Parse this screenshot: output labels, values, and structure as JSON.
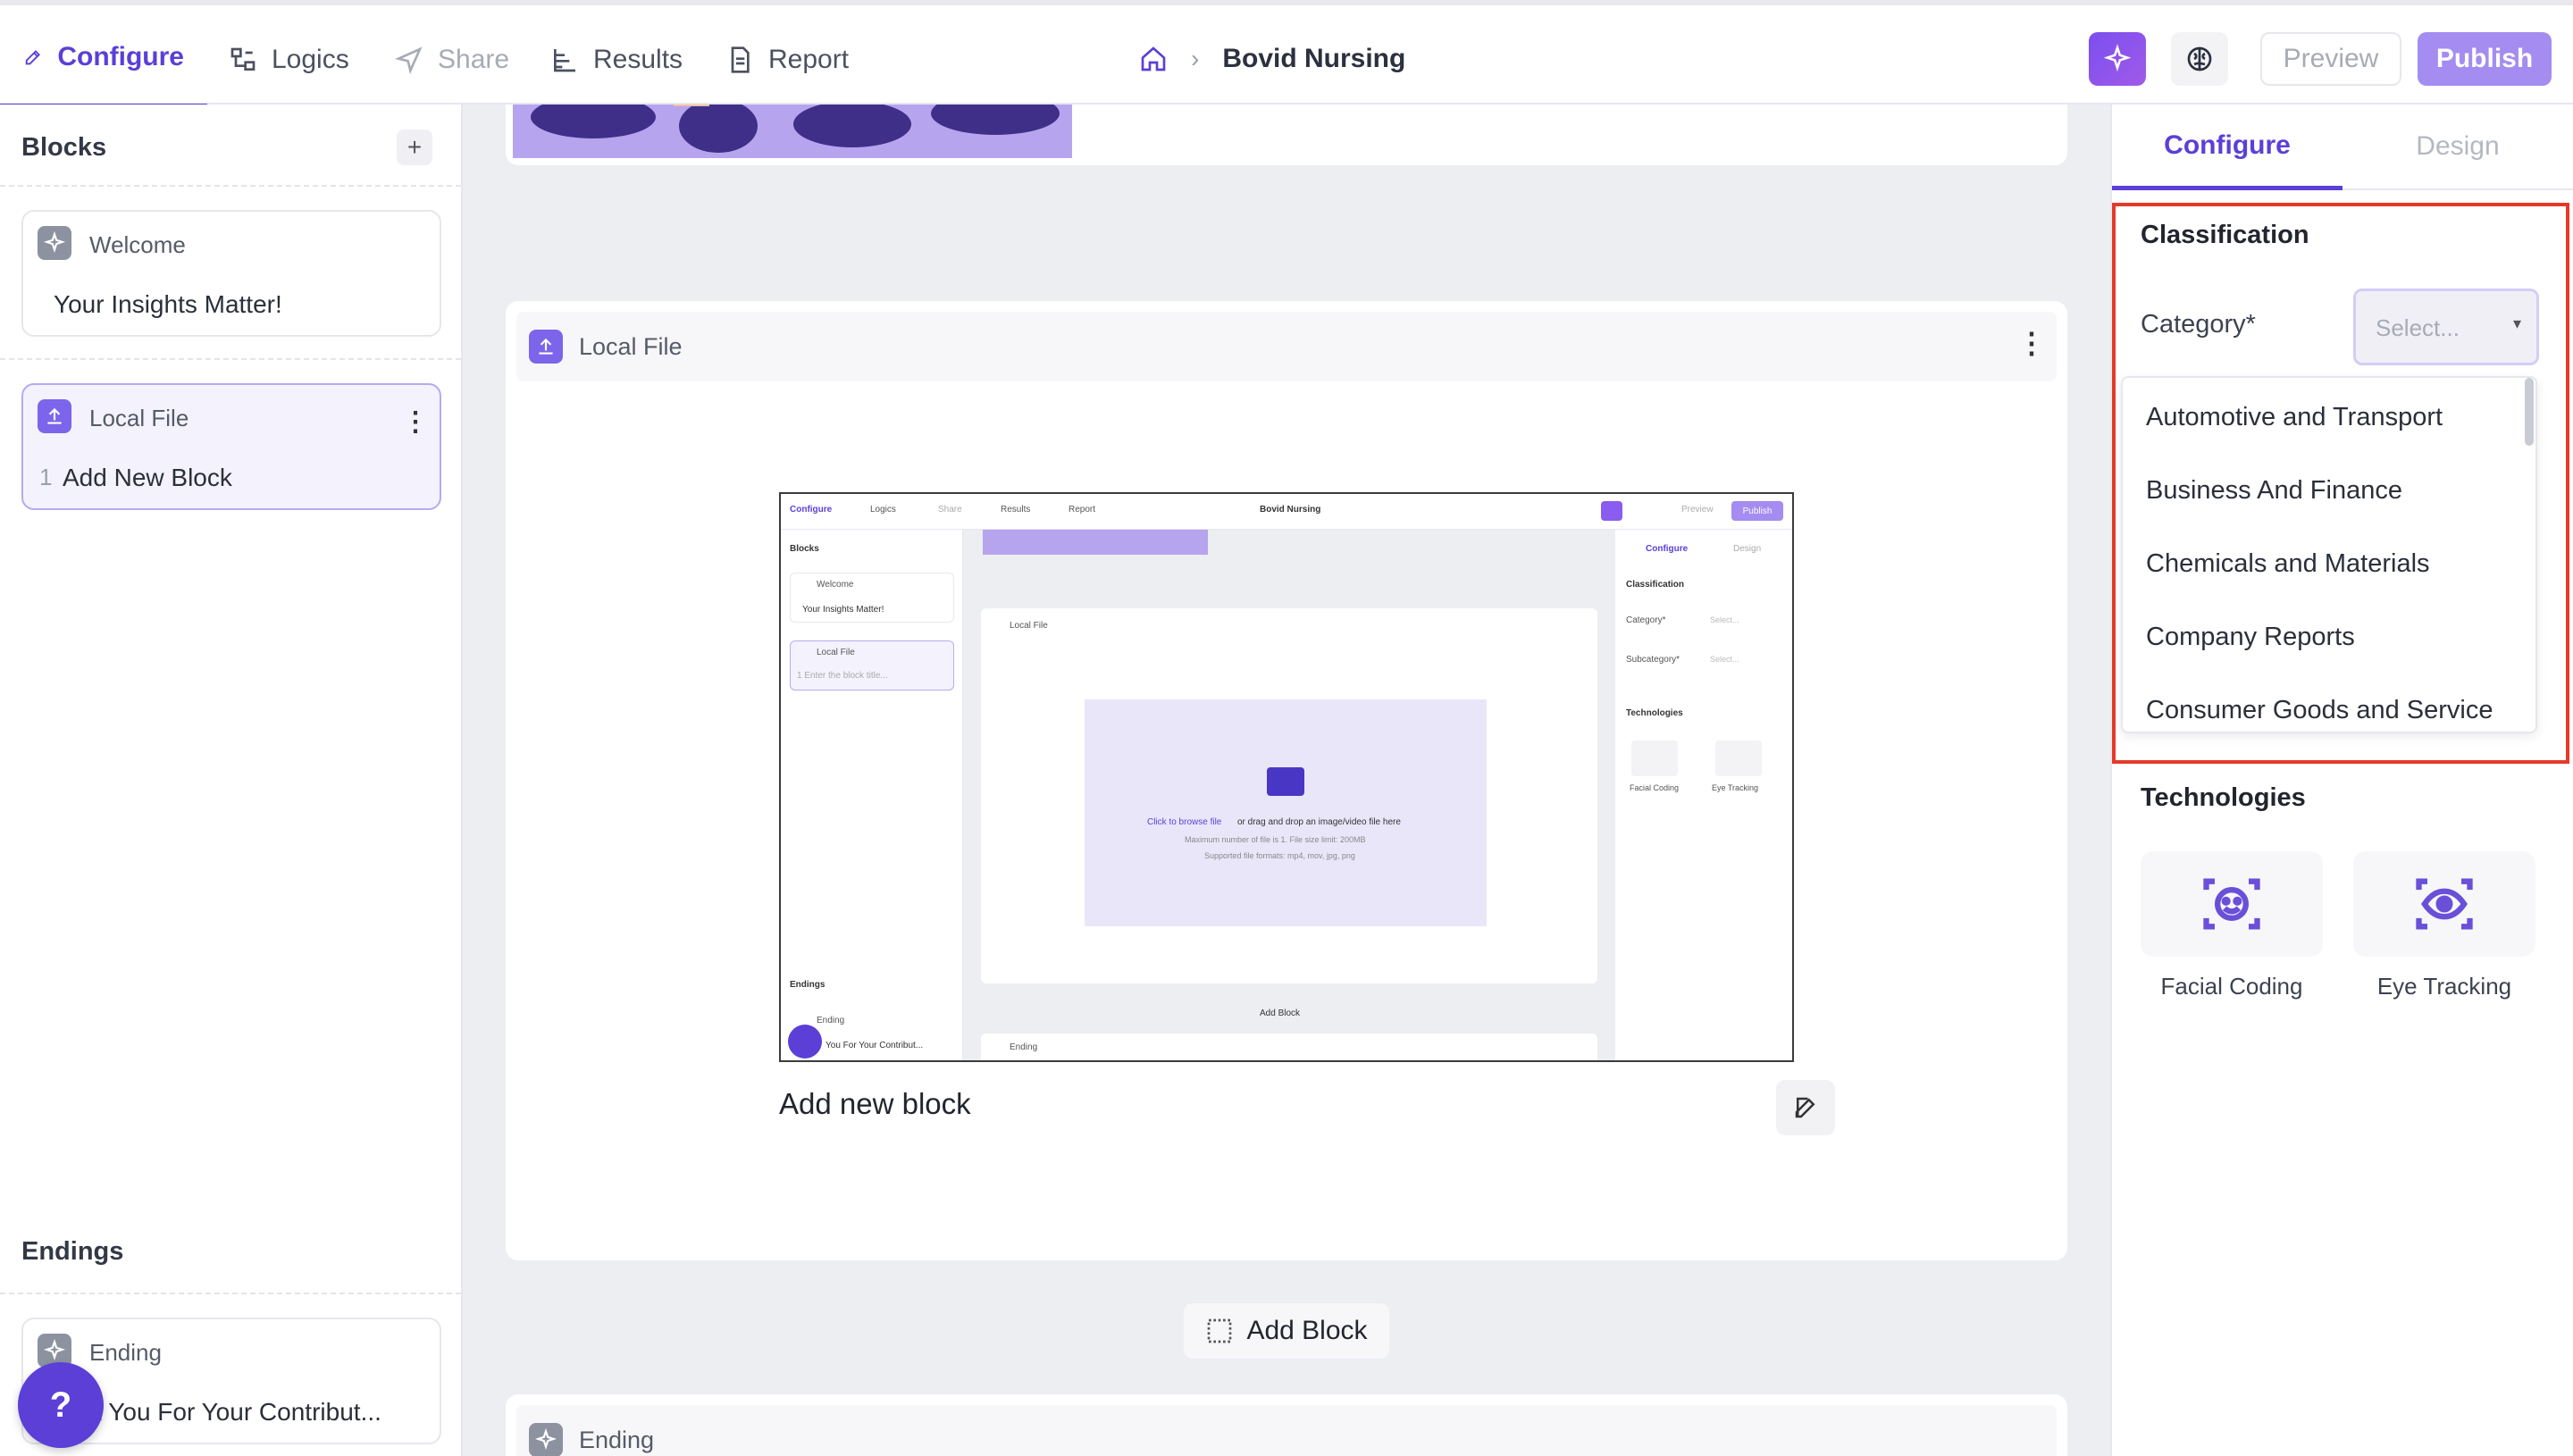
{
  "topbar": {
    "tabs": [
      {
        "label": "Configure",
        "icon": "pencil-icon"
      },
      {
        "label": "Logics",
        "icon": "logic-icon"
      },
      {
        "label": "Share",
        "icon": "send-icon"
      },
      {
        "label": "Results",
        "icon": "results-icon"
      },
      {
        "label": "Report",
        "icon": "report-icon"
      }
    ],
    "breadcrumb_title": "Bovid Nursing",
    "preview_label": "Preview",
    "publish_label": "Publish"
  },
  "sidebar": {
    "blocks_heading": "Blocks",
    "add_symbol": "+",
    "welcome_card": {
      "title": "Welcome",
      "subtitle": "Your Insights Matter!"
    },
    "local_file_card": {
      "title": "Local File",
      "item_number": "1",
      "item_label": "Add New Block"
    },
    "endings_heading": "Endings",
    "ending_card": {
      "title": "Ending",
      "subtitle": "k You For Your Contribut..."
    },
    "help_symbol": "?"
  },
  "canvas": {
    "local_file_title": "Local File",
    "block_caption": "Add new block",
    "add_block_label": "Add Block",
    "ending_title": "Ending"
  },
  "mini": {
    "tabs": [
      "Configure",
      "Logics",
      "Share",
      "Results",
      "Report"
    ],
    "title": "Bovid Nursing",
    "preview": "Preview",
    "publish": "Publish",
    "blocks": "Blocks",
    "welcome": "Welcome",
    "insights": "Your Insights Matter!",
    "local_file": "Local File",
    "enter_title": "1  Enter the block title...",
    "endings": "Endings",
    "ending": "Ending",
    "ending_sub": "You For Your Contribut...",
    "upload_link": "Click to browse file",
    "upload_rest": " or drag and drop an image/video file here",
    "max_text": "Maximum number of file is 1. File size limit: 200MB",
    "formats": "Supported file formats: mp4, mov, jpg, png",
    "add_block": "Add Block",
    "configure": "Configure",
    "design": "Design",
    "classification": "Classification",
    "category": "Category*",
    "subcategory": "Subcategory*",
    "select": "Select...",
    "technologies": "Technologies",
    "facial": "Facial Coding",
    "eye": "Eye Tracking"
  },
  "right": {
    "tab_configure": "Configure",
    "tab_design": "Design",
    "classification": "Classification",
    "category_label": "Category*",
    "select_placeholder": "Select...",
    "dropdown_options": [
      "Automotive and Transport",
      "Business And Finance",
      "Chemicals and Materials",
      "Company Reports",
      "Consumer Goods and Service"
    ],
    "technologies": "Technologies",
    "tech": [
      {
        "label": "Facial Coding",
        "icon": "facial-coding-icon"
      },
      {
        "label": "Eye Tracking",
        "icon": "eye-tracking-icon"
      }
    ]
  },
  "colors": {
    "accent": "#5b3fd6",
    "publish": "#a48cf0",
    "highlight": "#e53a2a"
  }
}
